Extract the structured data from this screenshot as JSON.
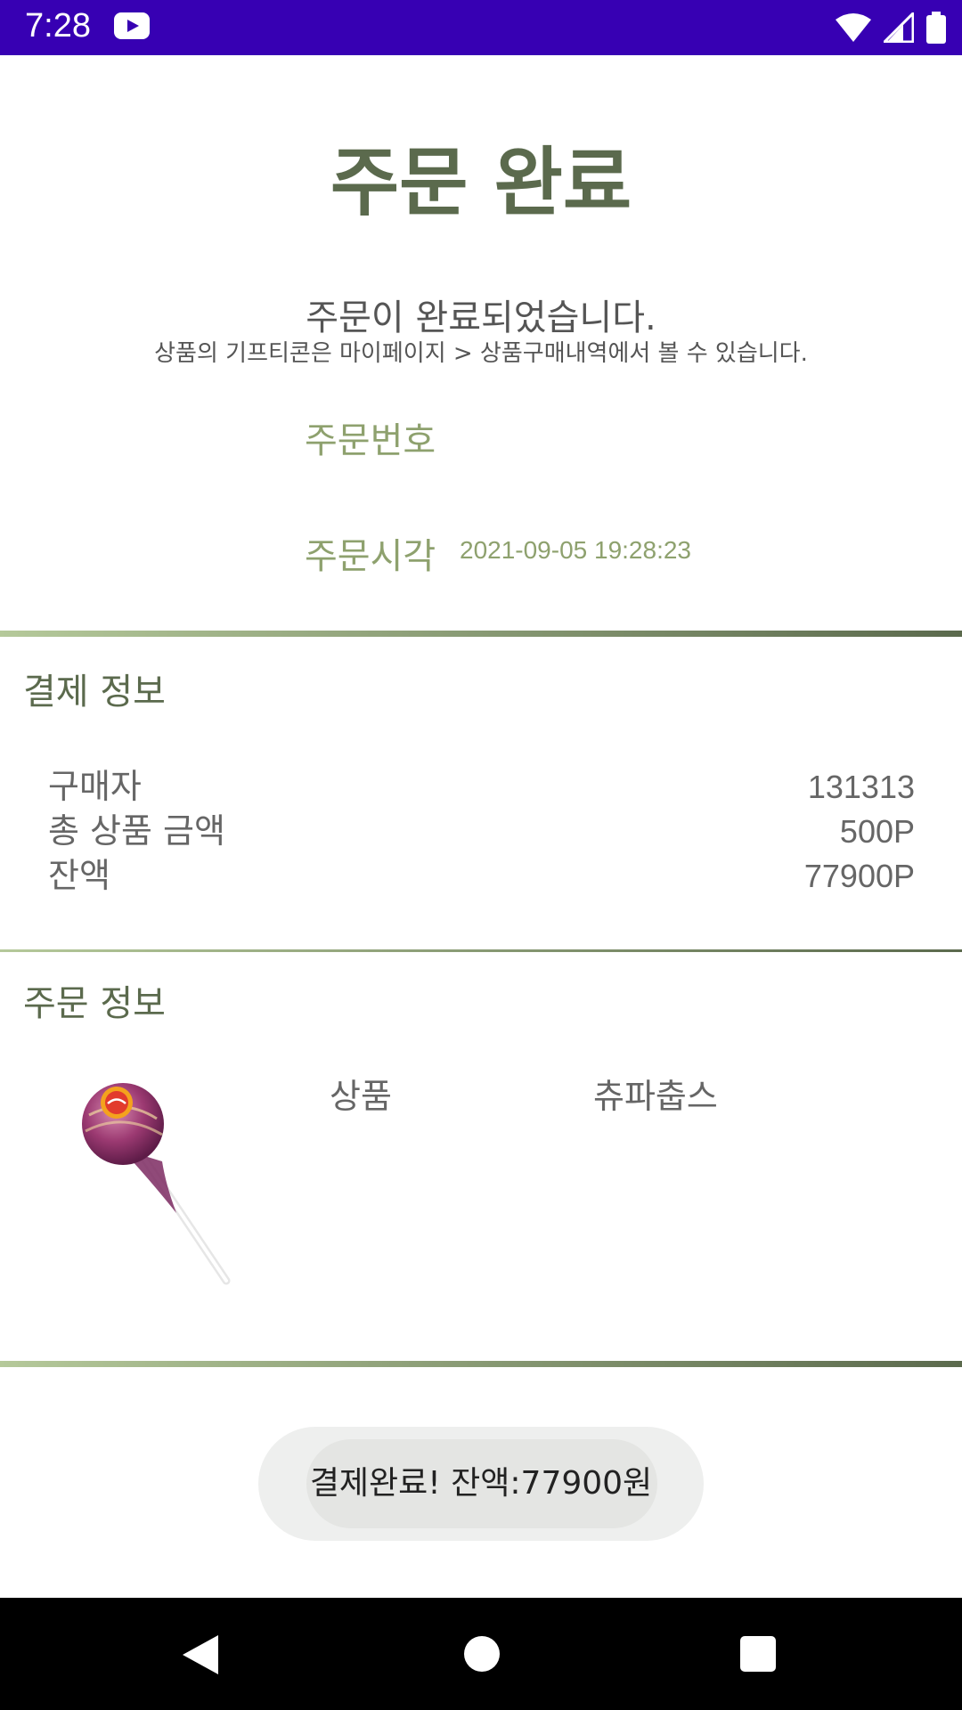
{
  "status_bar": {
    "time": "7:28",
    "icons": [
      "youtube-icon",
      "wifi-icon",
      "signal-icon",
      "battery-icon"
    ],
    "background": "#3700b3"
  },
  "header": {
    "title": "주문 완료",
    "message": "주문이 완료되었습니다.",
    "sub_message": "상품의 기프티콘은 마이페이지 > 상품구매내역에서 볼 수 있습니다."
  },
  "order": {
    "number_label": "주문번호",
    "time_label": "주문시각",
    "time_value": "2021-09-05 19:28:23"
  },
  "payment": {
    "section_title": "결제 정보",
    "rows": [
      {
        "label": "구매자",
        "value": "131313"
      },
      {
        "label": "총 상품 금액",
        "value": "500P"
      },
      {
        "label": "잔액",
        "value": "77900P"
      }
    ]
  },
  "order_info": {
    "section_title": "주문 정보",
    "product_label": "상품",
    "product_name": "츄파춥스",
    "image_icon": "lollipop-image"
  },
  "toast": {
    "text": "결제완료! 잔액:77900원"
  },
  "colors": {
    "title_green": "#5b6a4d",
    "accent_green": "#8ea16e",
    "divider_light": "#b5c99a"
  },
  "nav_bar": {
    "icons": [
      "back-icon",
      "home-icon",
      "recent-apps-icon"
    ]
  }
}
